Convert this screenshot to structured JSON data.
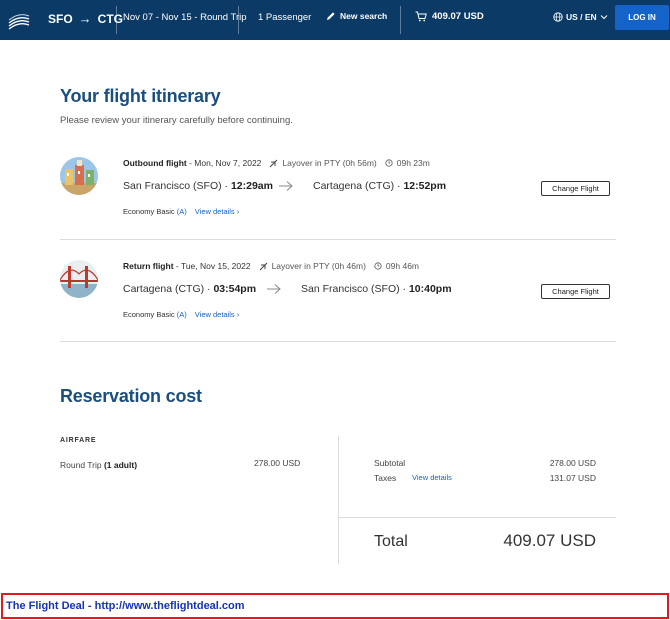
{
  "header": {
    "origin": "SFO",
    "arrow": "→",
    "destination": "CTG",
    "dates": "Nov 07 - Nov 15 - Round Trip",
    "passengers": "1 Passenger",
    "new_search": "New search",
    "cart_total": "409.07 USD",
    "locale": "US / EN",
    "login": "LOG IN"
  },
  "itinerary": {
    "title": "Your flight itinerary",
    "subtitle": "Please review your itinerary carefully before continuing.",
    "flights": [
      {
        "direction": "Outbound flight",
        "date": "- Mon, Nov 7, 2022",
        "layover": "Layover in PTY (0h 56m)",
        "duration": "09h 23m",
        "from_city": "San Francisco (SFO)",
        "from_time": "12:29am",
        "to_city": "Cartagena (CTG)",
        "to_time": "12:52pm",
        "sep": "·",
        "fare_class": "Economy Basic",
        "fare_code": "(A)",
        "view_details": "View details",
        "change": "Change Flight",
        "icon": "city-photo"
      },
      {
        "direction": "Return flight",
        "date": "- Tue, Nov 15, 2022",
        "layover": "Layover in PTY (0h 46m)",
        "duration": "09h 46m",
        "from_city": "Cartagena (CTG)",
        "from_time": "03:54pm",
        "to_city": "San Francisco (SFO)",
        "to_time": "10:40pm",
        "sep": "·",
        "fare_class": "Economy Basic",
        "fare_code": "(A)",
        "view_details": "View details",
        "change": "Change Flight",
        "icon": "golden-gate-photo"
      }
    ]
  },
  "cost": {
    "title": "Reservation cost",
    "airfare_label": "AIRFARE",
    "trip_label": "Round Trip",
    "trip_pax": "(1 adult)",
    "trip_amount": "278.00 USD",
    "subtotal_label": "Subtotal",
    "subtotal_amount": "278.00 USD",
    "taxes_label": "Taxes",
    "taxes_view": "View details",
    "taxes_amount": "131.07 USD",
    "total_label": "Total",
    "total_amount": "409.07 USD"
  },
  "banner": {
    "text": "The Flight Deal - http://www.theflightdeal.com"
  },
  "colors": {
    "header_bg": "#0b3a66",
    "accent": "#1463c8",
    "title": "#1a4e7f",
    "banner_border": "#e01b1b",
    "banner_text": "#1533b8"
  }
}
